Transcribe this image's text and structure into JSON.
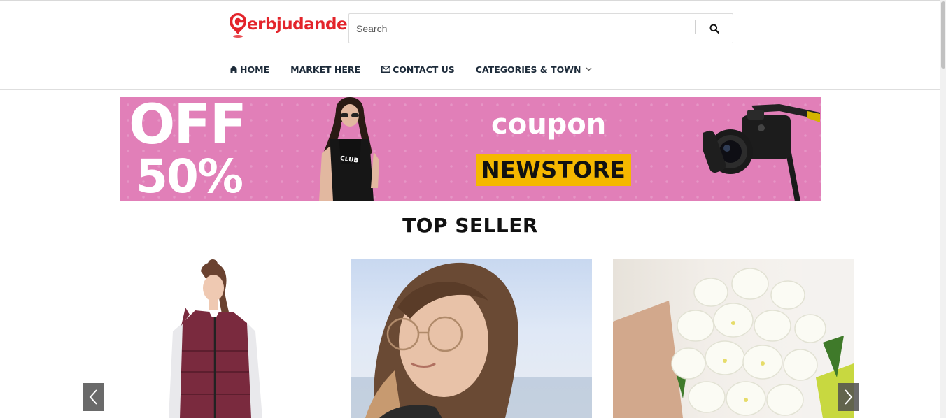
{
  "header": {
    "logo_text": "erbjudande.se",
    "search": {
      "placeholder": "Search"
    }
  },
  "nav": {
    "items": [
      {
        "label": "HOME",
        "icon": "home-icon"
      },
      {
        "label": "MARKET HERE"
      },
      {
        "label": "CONTACT US",
        "icon": "envelope-icon"
      },
      {
        "label": "CATEGORIES & TOWN",
        "icon": "chevron-down-icon"
      }
    ]
  },
  "banner": {
    "off": "OFF",
    "percent": "50%",
    "coupon": "coupon",
    "code": "NEWSTORE"
  },
  "top_seller": {
    "title": "TOP SELLER"
  },
  "colors": {
    "brand_red": "#e3242b",
    "nav_text": "#1d2b3a",
    "banner_pink": "#e17fb8",
    "coupon_yellow": "#f5b800"
  }
}
